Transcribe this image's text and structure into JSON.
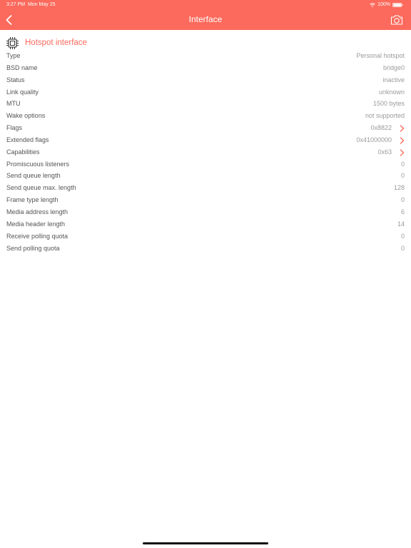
{
  "status_bar": {
    "time": "3:27 PM",
    "date": "Mon May 25",
    "battery": "100%"
  },
  "nav": {
    "title": "Interface",
    "back_icon": "chevron-left-icon",
    "action_icon": "camera-icon"
  },
  "section": {
    "title": "Hotspot interface",
    "icon": "chip-icon"
  },
  "colors": {
    "accent": "#fb6a5c",
    "label": "#555555",
    "value": "#9a9a9a"
  },
  "rows": [
    {
      "label": "Type",
      "value": "Personal hotspot"
    },
    {
      "label": "BSD name",
      "value": "bridge0"
    },
    {
      "label": "Status",
      "value": "inactive"
    },
    {
      "label": "Link quality",
      "value": "unknown"
    },
    {
      "label": "MTU",
      "value": "1500 bytes"
    },
    {
      "label": "Wake options",
      "value": "not supported"
    },
    {
      "label": "Flags",
      "value": "0x8822",
      "arrow": true
    },
    {
      "label": "Extended flags",
      "value": "0x41000000",
      "arrow": true
    },
    {
      "label": "Capabilities",
      "value": "0x63",
      "arrow": true
    },
    {
      "label": "Promiscuous listeners",
      "value": "0"
    },
    {
      "label": "Send queue length",
      "value": "0"
    },
    {
      "label": "Send queue max. length",
      "value": "128"
    },
    {
      "label": "Frame type length",
      "value": "0"
    },
    {
      "label": "Media address length",
      "value": "6"
    },
    {
      "label": "Media header length",
      "value": "14"
    },
    {
      "label": "Receive polling quota",
      "value": "0"
    },
    {
      "label": "Send polling quota",
      "value": "0"
    }
  ]
}
